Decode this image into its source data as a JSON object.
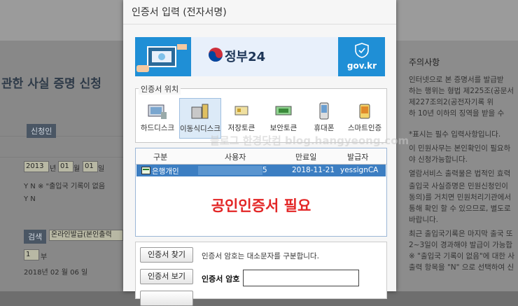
{
  "background_page": {
    "title": "관한 사실 증명 신청",
    "applicant_button": "신청인",
    "date_year": "2013",
    "date_year_unit": "년",
    "date_month": "01",
    "date_month_unit": "월",
    "date_day": "01",
    "date_day_unit": "일",
    "radio_row1_text": "Y  N ※ \"출입국 기록이 없음",
    "radio_row2_text": "Y  N",
    "search_button": "검색",
    "issue_method_value": "온라인발급(본인출력",
    "copies_value": "1",
    "copies_unit": "부",
    "issue_date_text": "2018년 02 월 06 일",
    "notice_title": "주의사항",
    "notice_lines": [
      "인터넷으로 본 증명서를 발급받",
      "하는 행위는 형법 제225조(공문서",
      "제227조의2(공전자기록 위",
      "하 10년 이하의 징역을 받을 수",
      "*표시는 필수 입력사항입니다.",
      "이 민원사무는 본인확인이 필요하",
      "야 신청가능합니다.",
      "열람서비스 출력물은 법적인 효력",
      "출입국 사실증명은 민원신청인이",
      "동의)를 거치면 민원처리기관에서",
      "통해 확인 할 수 있으므로, 별도로",
      "바랍니다.",
      "최근 출입국기록은 마지막 출국 또",
      "2~3일이 경과해야 발급이 가능합",
      "※ \"출입국 기록이 없음\"에 대한 사",
      "출력 항목을 \"N\" 으로 선택하여 신"
    ]
  },
  "dialog": {
    "title": "인증서 입력 (전자서명)",
    "banner": {
      "brand": "정부24",
      "domain": "gov.kr"
    },
    "location_group_label": "인증서 위치",
    "locations": [
      {
        "label": "하드디스크",
        "icon": "hard-disk-icon",
        "selected": false
      },
      {
        "label": "이동식디스크",
        "icon": "removable-disk-icon",
        "selected": true
      },
      {
        "label": "저장토큰",
        "icon": "storage-token-icon",
        "selected": false
      },
      {
        "label": "보안토큰",
        "icon": "security-token-icon",
        "selected": false
      },
      {
        "label": "휴대폰",
        "icon": "mobile-phone-icon",
        "selected": false
      },
      {
        "label": "스마트인증",
        "icon": "smart-auth-icon",
        "selected": false
      }
    ],
    "table": {
      "headers": [
        "구분",
        "사용자",
        "만료일",
        "발급자"
      ],
      "rows": [
        {
          "type": "은행개인",
          "user": "5",
          "expiry": "2018-11-21",
          "issuer": "yessignCA"
        }
      ]
    },
    "overlay_notice": "공인인증서 필요",
    "find_button": "인증서 찾기",
    "view_button": "인증서 보기",
    "case_notice": "인증서 암호는 대소문자를 구분합니다.",
    "password_label": "인증서 암호",
    "password_value": ""
  },
  "watermark": "블로그 한경닷컴 blog.hangyeong.com",
  "colors": {
    "selection": "#3c7ec2",
    "notice_red": "#e32626",
    "banner_blue": "#1f8fd6"
  }
}
